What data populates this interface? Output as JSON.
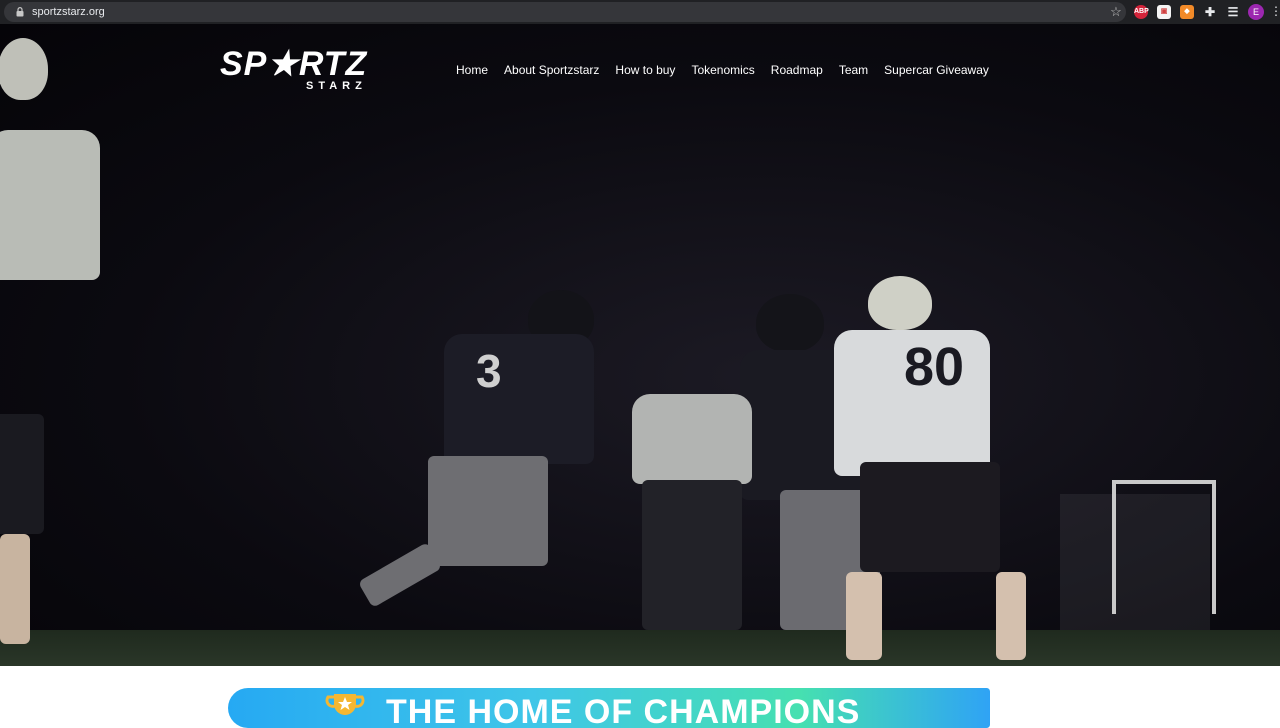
{
  "browser": {
    "url": "sportzstarz.org",
    "extensions": [
      "ABP",
      "ext-2",
      "ext-3"
    ],
    "profile_initial": "E"
  },
  "site": {
    "logo_main": "SP★RTZ",
    "logo_sub": "STARZ",
    "nav": [
      "Home",
      "About Sportzstarz",
      "How to buy",
      "Tokenomics",
      "Roadmap",
      "Team",
      "Supercar Giveaway"
    ]
  },
  "hero": {
    "jersey_number_a": "80",
    "jersey_number_b": "3"
  },
  "banner": {
    "text": "THE HOME OF CHAMPIONS"
  },
  "icons": [
    "lock-icon",
    "star-icon",
    "puzzle-icon",
    "queue-icon",
    "menu-kebab-icon",
    "trophy-icon"
  ],
  "colors": {
    "chrome_bg": "#202124",
    "hero_bg": "#0b0a10",
    "banner_start": "#26a9f3",
    "banner_end": "#46e0b0"
  }
}
